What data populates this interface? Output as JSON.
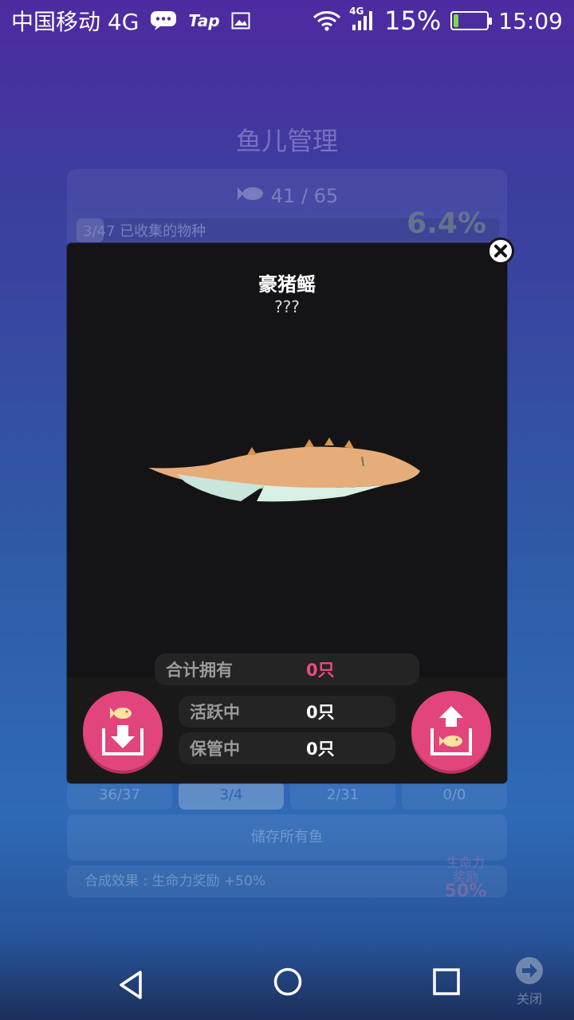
{
  "status_bar": {
    "carrier": "中国移动 4G",
    "app_icon_text": "Tap",
    "network_badge": "4G",
    "battery_percent": "15%",
    "battery_level": 0.15,
    "time": "15:09",
    "icons": [
      "message-icon",
      "image-icon",
      "wifi-icon",
      "signal-icon",
      "battery-icon"
    ]
  },
  "background_page": {
    "title": "鱼儿管理",
    "fish_count": "41 / 65",
    "collected_count": "3/47",
    "collected_label": "已收集的物种",
    "collected_percent": "6.4%",
    "collected_fraction": 0.064,
    "tabs": [
      "36/37",
      "3/4",
      "2/31",
      "0/0"
    ],
    "active_tab": 1,
    "store_all_label": "储存所有鱼",
    "synthesis_effect": "合成效果 : 生命力奖励 +50%",
    "heart_label_line1": "生命力",
    "heart_label_line2": "奖励",
    "heart_percent": "50%"
  },
  "modal": {
    "fish_name": "豪猪鳐",
    "fish_subtitle": "???",
    "stats": {
      "total_label": "合计拥有",
      "total_value": "0只",
      "active_label": "活跃中",
      "active_value": "0只",
      "stored_label": "保管中",
      "stored_value": "0只"
    },
    "store_button_icon": "fish-store-icon",
    "release_button_icon": "fish-release-icon",
    "colors": {
      "accent": "#e2457d",
      "highlight_value": "#e94b84",
      "panel": "#141416"
    }
  },
  "nav_bar": {
    "close_label": "关闭",
    "icons": [
      "back-icon",
      "home-icon",
      "recents-icon",
      "close-arrow-icon"
    ]
  }
}
